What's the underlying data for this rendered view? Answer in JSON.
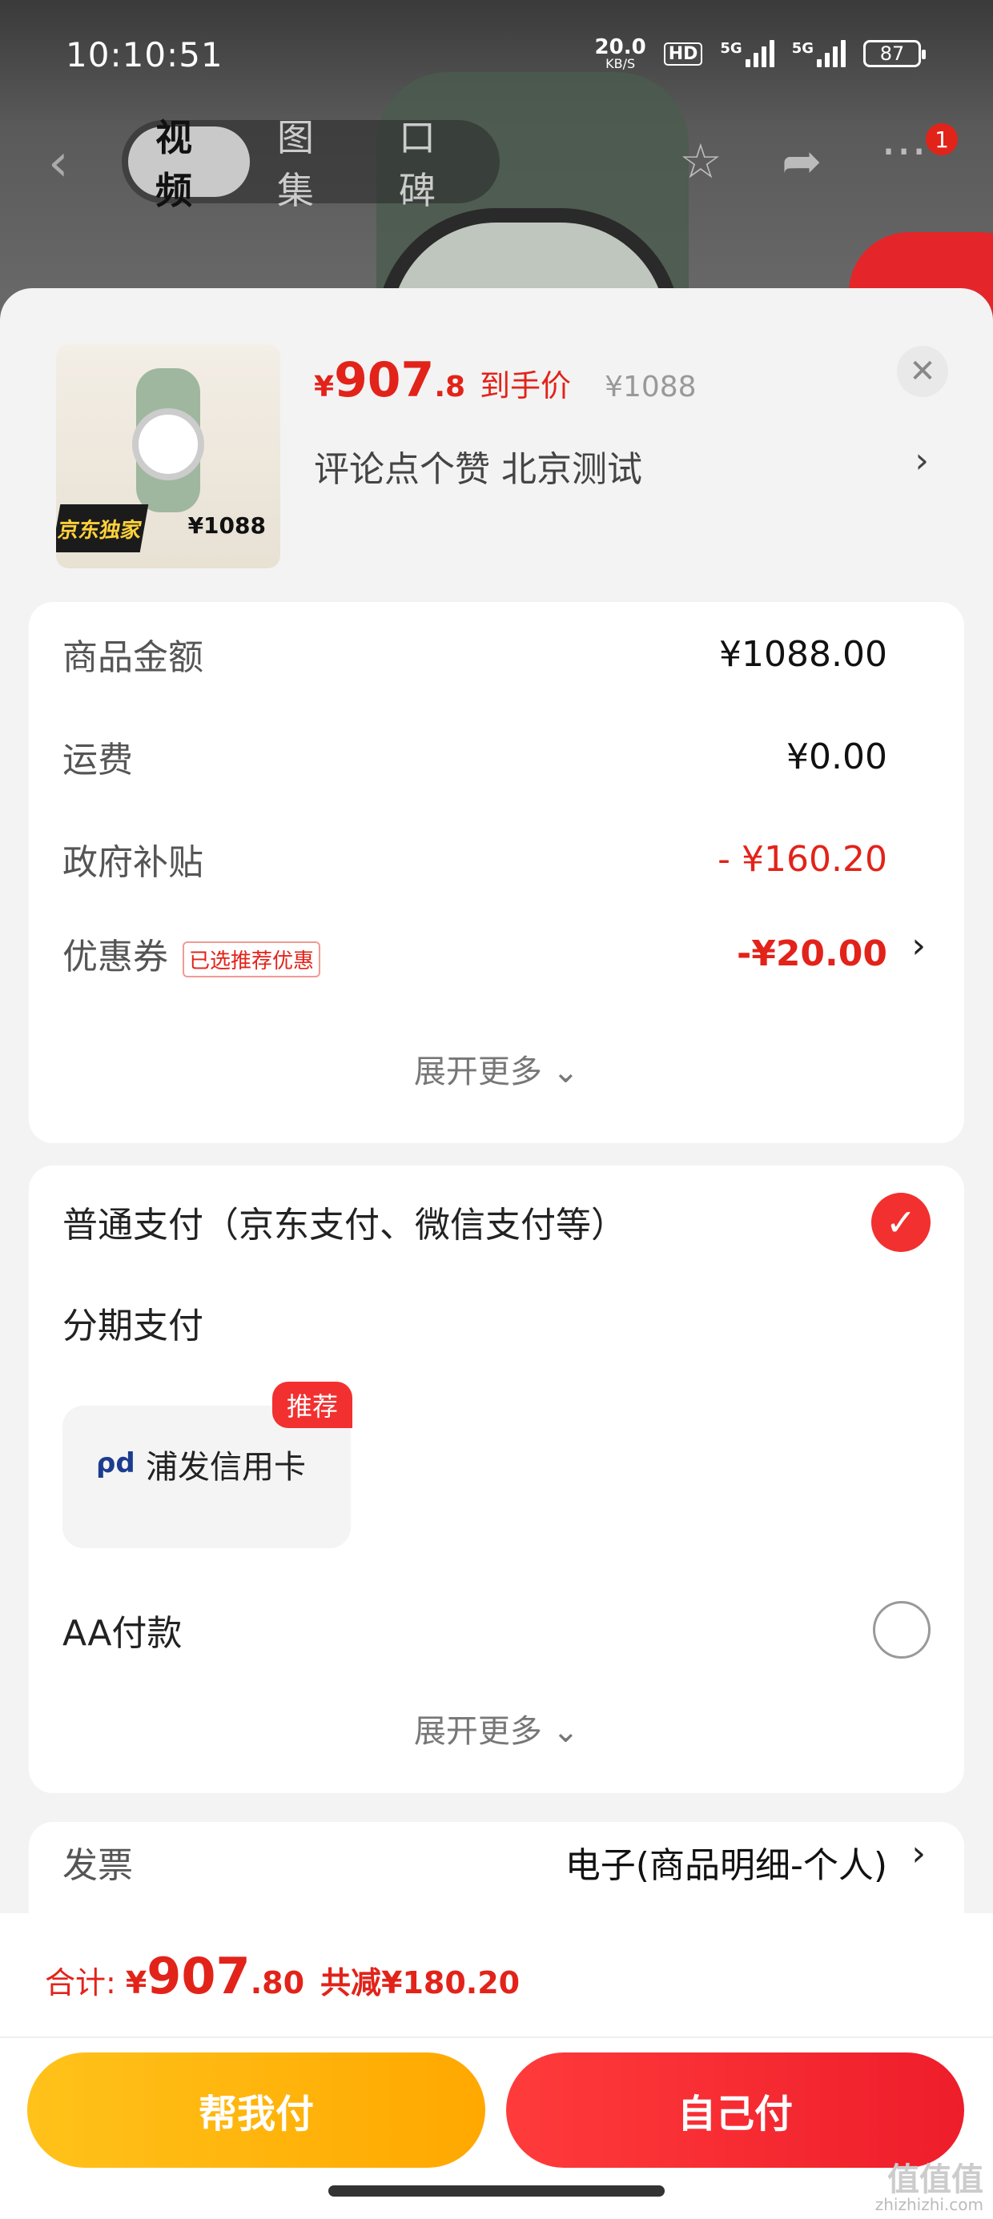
{
  "status": {
    "time": "10:10:51",
    "net_speed": "20.0",
    "net_unit": "KB/S",
    "hd": "HD",
    "sig1": "5G",
    "sig2": "5G",
    "battery": "87"
  },
  "nav": {
    "tabs": [
      "视频",
      "图集",
      "口碑"
    ],
    "active_tab": 0,
    "badge": "1"
  },
  "product": {
    "currency": "¥",
    "price_int": "907",
    "price_dec": ".8",
    "price_tag": "到手价",
    "orig": "¥1088",
    "desc": "评论点个赞  北京测试",
    "thumb_label": "京东独家",
    "thumb_price": "¥1088"
  },
  "fees": [
    {
      "k": "商品金额",
      "v": "¥1088.00",
      "red": false
    },
    {
      "k": "运费",
      "v": "¥0.00",
      "red": false
    },
    {
      "k": "政府补贴",
      "v": "- ¥160.20",
      "red": true
    },
    {
      "k": "优惠券",
      "chip": "已选推荐优惠",
      "v": "-¥20.00",
      "red": true
    }
  ],
  "more_label": "展开更多",
  "payment": {
    "normal": "普通支付（京东支付、微信支付等）",
    "installment": "分期支付",
    "bank": "浦发信用卡",
    "recommend": "推荐",
    "aa": "AA付款",
    "more_label": "展开更多"
  },
  "invoice": {
    "k": "发票",
    "v": "电子(商品明细-个人)"
  },
  "total": {
    "label": "合计:",
    "currency": "¥",
    "int": "907",
    "dec": ".80",
    "save": "共减¥180.20"
  },
  "buttons": {
    "help": "帮我付",
    "self": "自己付"
  },
  "watermark": {
    "logo": "值值值",
    "url": "zhizhizhi.com"
  },
  "colors": {
    "accent": "#e2231a",
    "yellow": "#ffb400"
  }
}
